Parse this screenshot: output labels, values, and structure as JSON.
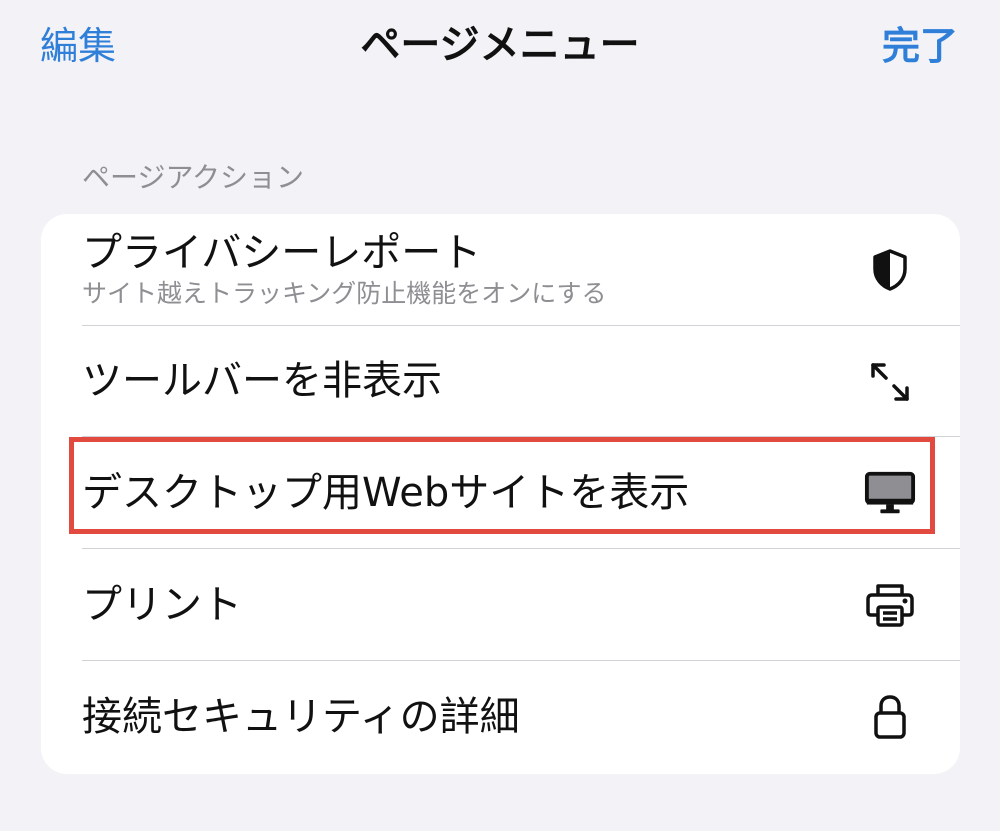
{
  "nav": {
    "edit_label": "編集",
    "title": "ページメニュー",
    "done_label": "完了"
  },
  "section": {
    "header": "ページアクション"
  },
  "items": [
    {
      "label": "プライバシーレポート",
      "sublabel": "サイト越えトラッキング防止機能をオンにする",
      "icon": "shield-icon"
    },
    {
      "label": "ツールバーを非表示",
      "icon": "expand-arrows-icon"
    },
    {
      "label": "デスクトップ用Webサイトを表示",
      "icon": "desktop-monitor-icon",
      "highlighted": true
    },
    {
      "label": "プリント",
      "icon": "printer-icon"
    },
    {
      "label": "接続セキュリティの詳細",
      "icon": "lock-icon"
    }
  ],
  "colors": {
    "accent": "#2f7fd9",
    "highlight_border": "#e2493f",
    "background": "#f2f2f7",
    "card": "#ffffff"
  }
}
